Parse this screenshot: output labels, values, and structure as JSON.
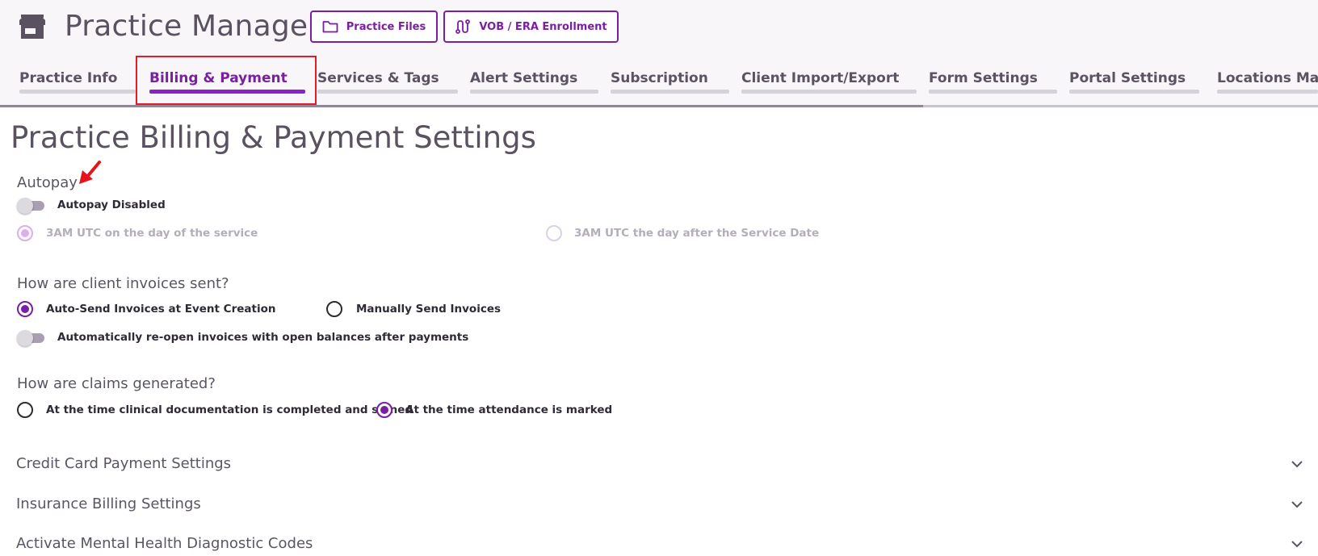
{
  "header": {
    "title": "Practice Manager",
    "practice_files_label": "Practice Files",
    "vob_label": "VOB / ERA Enrollment"
  },
  "tabs": [
    {
      "label": "Practice Info",
      "active": false
    },
    {
      "label": "Billing & Payment",
      "active": true
    },
    {
      "label": "Services & Tags",
      "active": false
    },
    {
      "label": "Alert Settings",
      "active": false
    },
    {
      "label": "Subscription",
      "active": false
    },
    {
      "label": "Client Import/Export",
      "active": false
    },
    {
      "label": "Form Settings",
      "active": false
    },
    {
      "label": "Portal Settings",
      "active": false
    },
    {
      "label": "Locations Mana",
      "active": false
    }
  ],
  "page_title": "Practice Billing & Payment Settings",
  "autopay": {
    "label": "Autopay",
    "toggle_label": "Autopay Disabled",
    "toggle_on": false,
    "option_same_day": "3AM UTC on the day of the service",
    "option_day_after": "3AM UTC the day after the Service Date",
    "selected": "same_day",
    "options_disabled": true
  },
  "invoices": {
    "label": "How are client invoices sent?",
    "option_auto": "Auto-Send Invoices at Event Creation",
    "option_manual": "Manually Send Invoices",
    "selected": "auto",
    "reopen_label": "Automatically re-open invoices with open balances after payments",
    "reopen_on": false
  },
  "claims": {
    "label": "How are claims generated?",
    "option_documentation": "At the time clinical documentation is completed and signed",
    "option_attendance": "At the time attendance is marked",
    "selected": "attendance"
  },
  "accordions": [
    {
      "label": "Credit Card Payment Settings"
    },
    {
      "label": "Insurance Billing Settings"
    },
    {
      "label": "Activate Mental Health Diagnostic Codes"
    }
  ],
  "colors": {
    "accent": "#7a1fa2",
    "active_tab_bar": "#8a22c8",
    "highlight_box": "#e21d2a",
    "annotation_arrow": "#e8121c"
  },
  "icons": {
    "header_icon": "store-icon",
    "practice_files_icon": "folder-icon",
    "vob_icon": "route-icon",
    "accordion_icon": "chevron-down-icon",
    "annotation": "red-arrow-icon"
  }
}
